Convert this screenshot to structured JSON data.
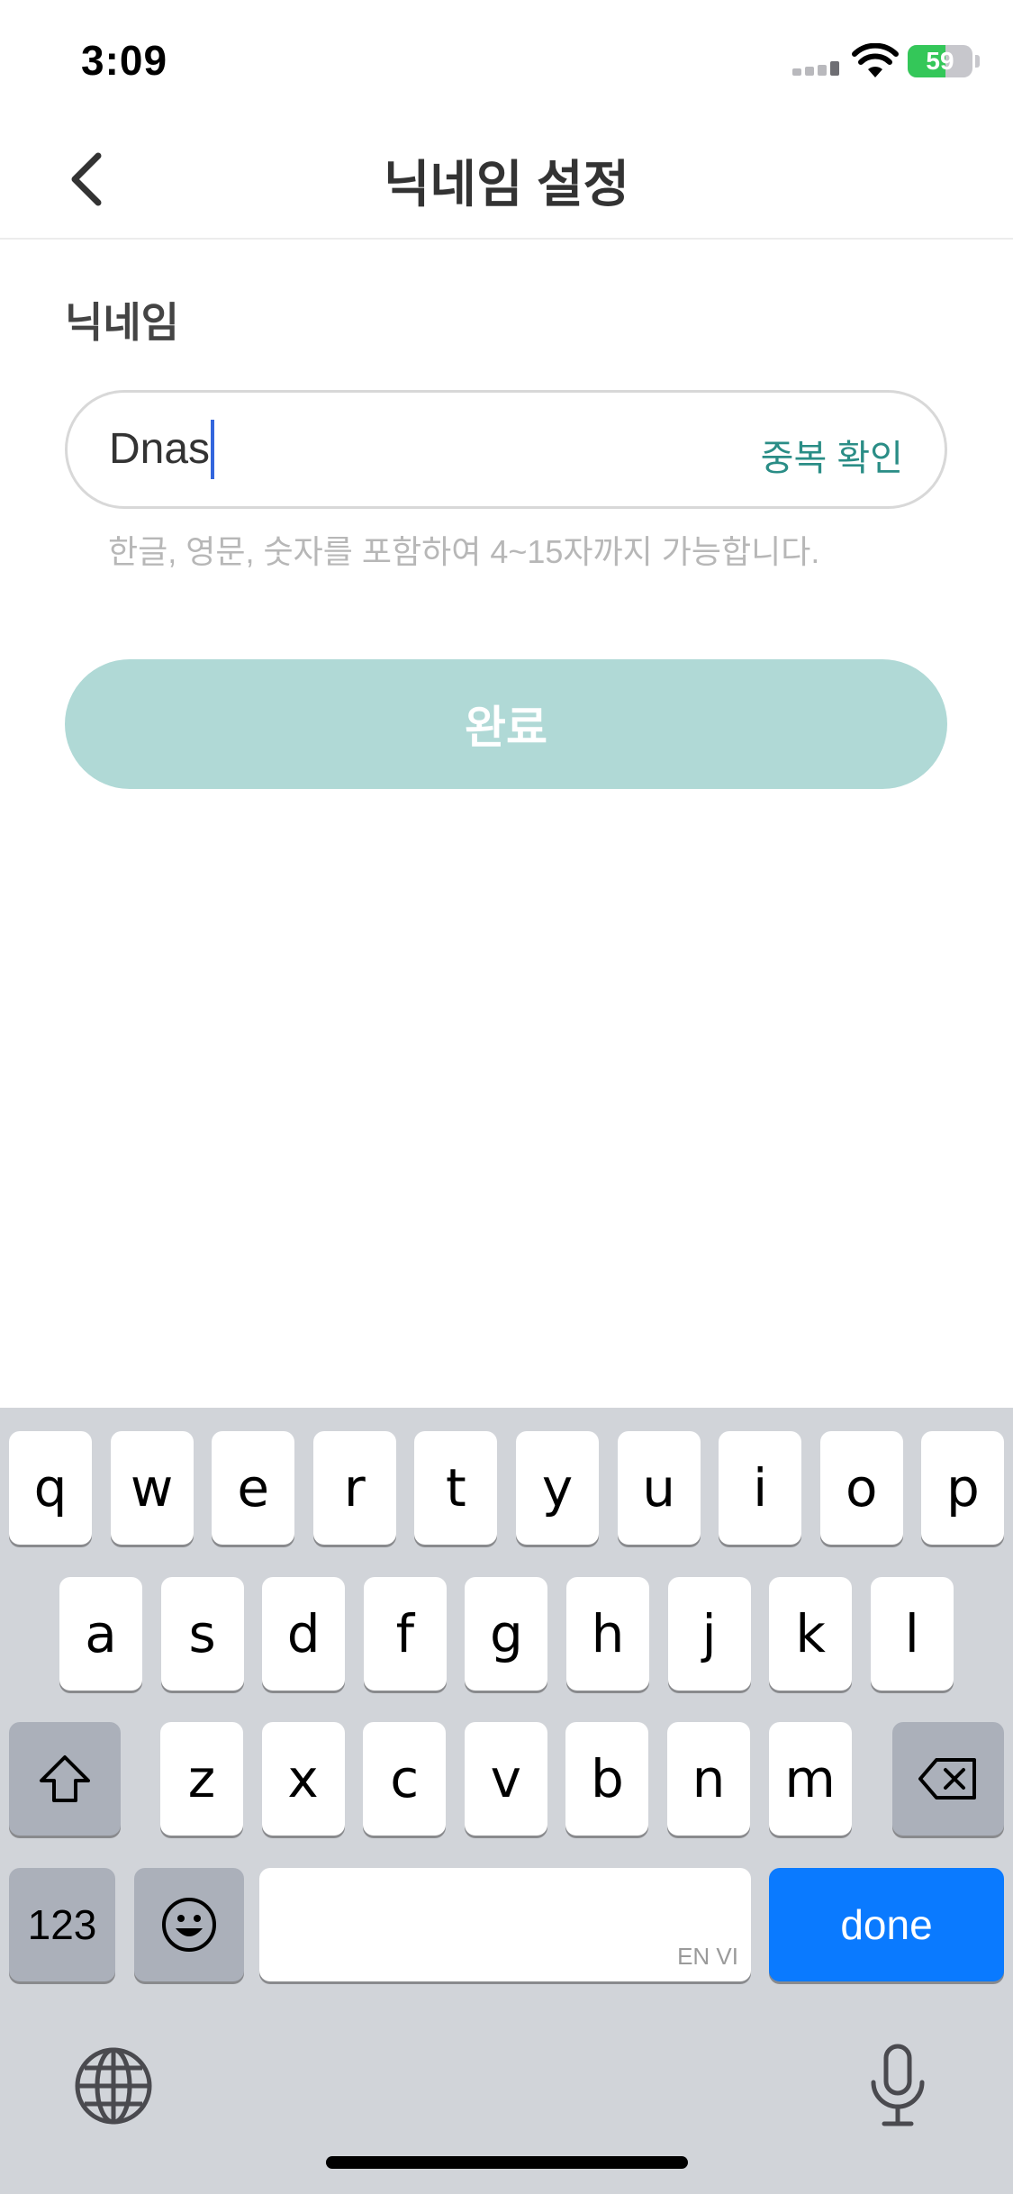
{
  "status_bar": {
    "time": "3:09",
    "battery_level": "59",
    "battery_percent": 59,
    "icons": [
      "signal-icon",
      "wifi-icon",
      "battery-charging-icon"
    ]
  },
  "nav": {
    "title": "닉네임 설정",
    "back_icon": "chevron-left-icon"
  },
  "form": {
    "label": "닉네임",
    "value": "Dnas",
    "duplicate_check": "중복 확인",
    "hint": "한글, 영문, 숫자를 포함하여 4~15자까지 가능합니다.",
    "submit": "완료"
  },
  "keyboard": {
    "row1": [
      "q",
      "w",
      "e",
      "r",
      "t",
      "y",
      "u",
      "i",
      "o",
      "p"
    ],
    "row2": [
      "a",
      "s",
      "d",
      "f",
      "g",
      "h",
      "j",
      "k",
      "l"
    ],
    "row3": [
      "z",
      "x",
      "c",
      "v",
      "b",
      "n",
      "m"
    ],
    "numbers_key": "123",
    "space_lang": "EN VI",
    "done_key": "done",
    "icons": [
      "shift-icon",
      "backspace-icon",
      "emoji-icon",
      "globe-icon",
      "microphone-icon"
    ]
  },
  "colors": {
    "accent": "#2a8d86",
    "submit_disabled": "#b0d9d6",
    "done_blue": "#0a7aff",
    "battery_green": "#34c759"
  }
}
